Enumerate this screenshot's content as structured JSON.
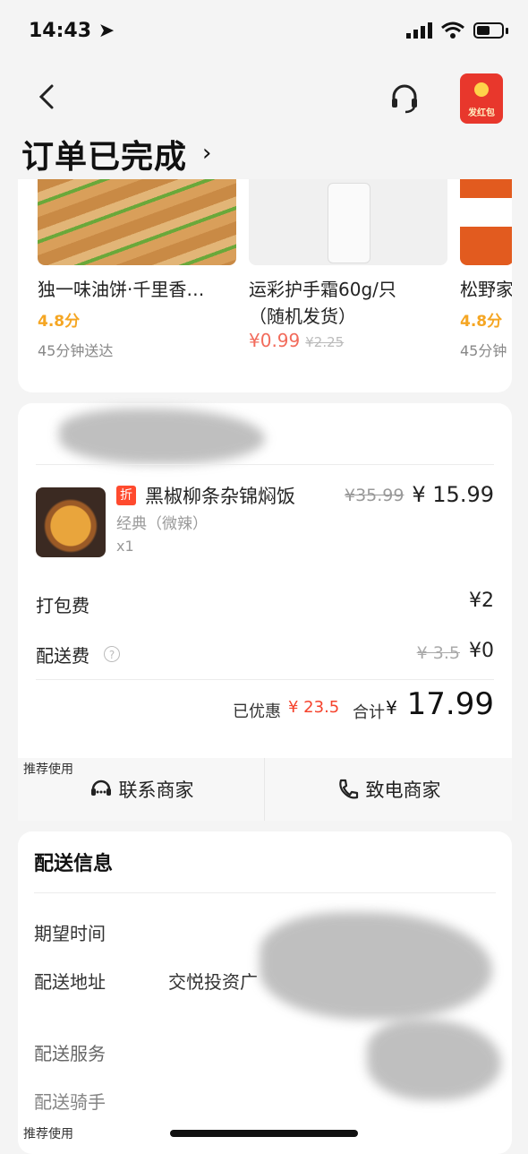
{
  "status_bar": {
    "time": "14:43"
  },
  "header": {
    "title": "订单已完成",
    "title_chevron": "›",
    "redpacket_label": "发红包"
  },
  "recommendations": [
    {
      "name": "独一味油饼·千里香…",
      "rating": "4.8分",
      "delivery": "45分钟送达"
    },
    {
      "name": "运彩护手霜60g/只（随机发货）",
      "price": "¥0.99",
      "original_price": "¥2.25"
    },
    {
      "name": "松野家",
      "rating": "4.8分",
      "delivery": "45分钟"
    }
  ],
  "order": {
    "dish": {
      "tag": "折",
      "name": "黑椒柳条杂锦焖饭",
      "spec": "经典（微辣）",
      "qty": "x1",
      "original_price": "¥35.99",
      "price": "¥ 15.99"
    },
    "packing_fee": {
      "label": "打包费",
      "value": "¥2"
    },
    "delivery_fee": {
      "label": "配送费",
      "original": "¥ 3.5",
      "value": "¥0"
    },
    "discount_label": "已优惠",
    "discount_value": "¥ 23.5",
    "total_label": "合计",
    "total_currency": "¥",
    "total_value": "17.99",
    "recommend_use": "推荐使用",
    "contact_merchant": "联系商家",
    "call_merchant": "致电商家"
  },
  "delivery_info": {
    "title": "配送信息",
    "expected_time_label": "期望时间",
    "address_label": "配送地址",
    "address_value": "交悦投资广",
    "service_label": "配送服务",
    "rider_label": "配送骑手",
    "recommend_use": "推荐使用"
  },
  "colors": {
    "accent_orange": "#f5a623",
    "price_red": "#f5432d",
    "redpacket": "#e8372c"
  }
}
